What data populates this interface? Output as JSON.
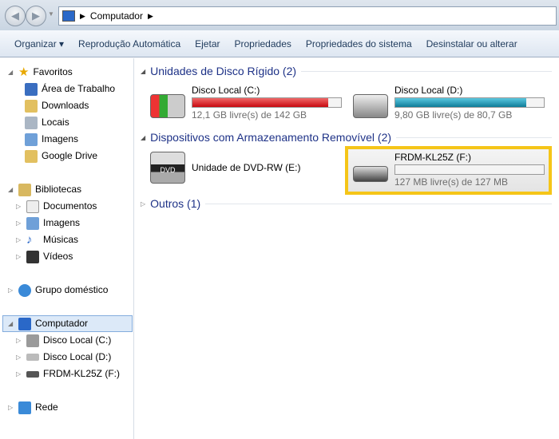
{
  "address": {
    "path": [
      "Computador"
    ]
  },
  "toolbar": [
    "Organizar ▾",
    "Reprodução Automática",
    "Ejetar",
    "Propriedades",
    "Propriedades do sistema",
    "Desinstalar ou alterar"
  ],
  "sidebar": {
    "favorites": {
      "label": "Favoritos",
      "items": [
        "Área de Trabalho",
        "Downloads",
        "Locais",
        "Imagens",
        "Google Drive"
      ]
    },
    "libraries": {
      "label": "Bibliotecas",
      "items": [
        "Documentos",
        "Imagens",
        "Músicas",
        "Vídeos"
      ]
    },
    "homegroup": "Grupo doméstico",
    "computer": {
      "label": "Computador",
      "items": [
        "Disco Local (C:)",
        "Disco Local (D:)",
        "FRDM-KL25Z (F:)"
      ]
    },
    "network": "Rede"
  },
  "groups": {
    "hdd": {
      "title": "Unidades de Disco Rígido (2)",
      "drives": [
        {
          "name": "Disco Local (C:)",
          "free": "12,1 GB livre(s) de 142 GB",
          "used_fraction": 0.915,
          "color": "#d4141a"
        },
        {
          "name": "Disco Local (D:)",
          "free": "9,80 GB livre(s) de 80,7 GB",
          "used_fraction": 0.88,
          "color": "#1e9cb8"
        }
      ]
    },
    "removable": {
      "title": "Dispositivos com Armazenamento Removível (2)",
      "dvd": "Unidade de DVD-RW (E:)",
      "usb": {
        "name": "FRDM-KL25Z (F:)",
        "free": "127 MB livre(s) de 127 MB",
        "used_fraction": 0
      }
    },
    "others": {
      "title": "Outros (1)"
    }
  },
  "highlight_color": "#f5c518"
}
